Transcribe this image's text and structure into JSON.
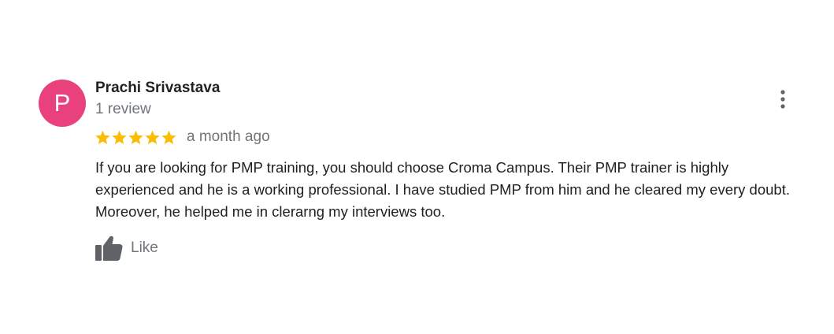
{
  "reviewer": {
    "avatar_letter": "P",
    "avatar_color": "#e8417c",
    "name": "Prachi Srivastava",
    "review_count": "1 review"
  },
  "review": {
    "rating": 5,
    "max_rating": 5,
    "star_color": "#fbbc04",
    "time_ago": "a month ago",
    "text": "If you are looking for PMP training, you should choose Croma Campus. Their PMP trainer is highly experienced and he is a working professional. I have studied PMP from him and he cleared my every doubt. Moreover, he helped me in clerarng my interviews too."
  },
  "actions": {
    "like_label": "Like",
    "like_icon": "thumbs-up-icon",
    "more_icon": "more-vert-icon"
  }
}
